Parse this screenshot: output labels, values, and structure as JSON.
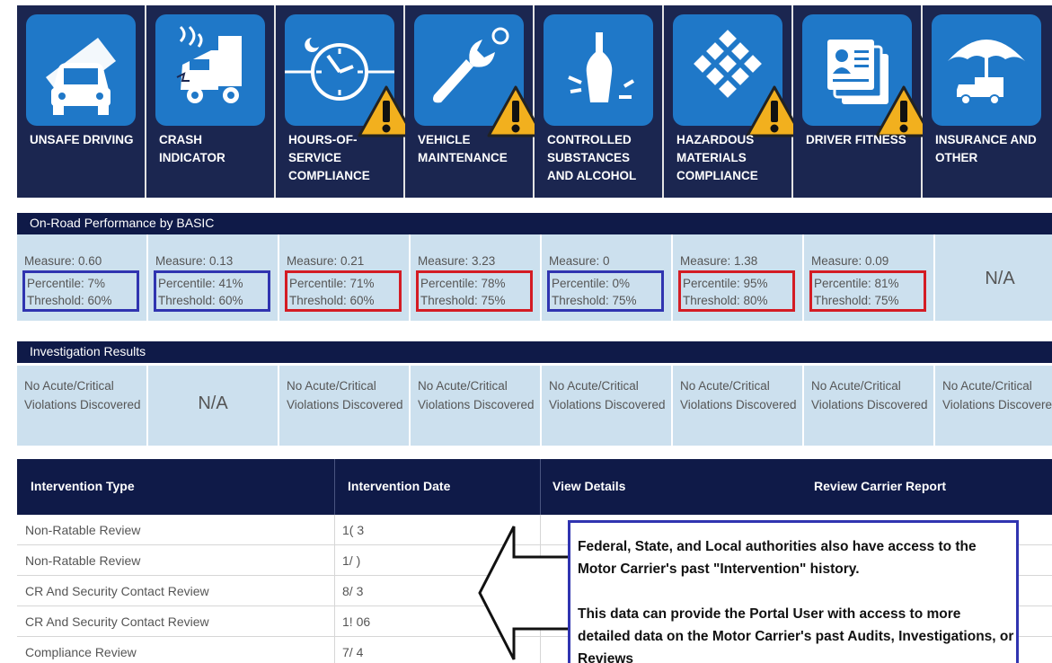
{
  "basics": [
    {
      "label": "UNSAFE DRIVING",
      "icon": "unsafe-driving-icon",
      "warning": false
    },
    {
      "label": "CRASH INDICATOR",
      "icon": "crash-indicator-icon",
      "warning": false
    },
    {
      "label": "HOURS-OF-SERVICE COMPLIANCE",
      "icon": "hours-of-service-icon",
      "warning": true
    },
    {
      "label": "VEHICLE MAINTENANCE",
      "icon": "vehicle-maintenance-icon",
      "warning": true
    },
    {
      "label": "CONTROLLED SUBSTANCES AND ALCOHOL",
      "icon": "controlled-substances-icon",
      "warning": false
    },
    {
      "label": "HAZARDOUS MATERIALS COMPLIANCE",
      "icon": "hazardous-materials-icon",
      "warning": true
    },
    {
      "label": "DRIVER FITNESS",
      "icon": "driver-fitness-icon",
      "warning": true
    },
    {
      "label": "INSURANCE AND OTHER",
      "icon": "insurance-icon",
      "warning": false
    }
  ],
  "on_road": {
    "title": "On-Road Performance by BASIC",
    "cells": [
      {
        "measure": "Measure: 0.60",
        "percentile": "Percentile: 7%",
        "threshold": "Threshold: 60%",
        "highlight": "blue"
      },
      {
        "measure": "Measure: 0.13",
        "percentile": "Percentile: 41%",
        "threshold": "Threshold: 60%",
        "highlight": "blue"
      },
      {
        "measure": "Measure: 0.21",
        "percentile": "Percentile: 71%",
        "threshold": "Threshold: 60%",
        "highlight": "red"
      },
      {
        "measure": "Measure: 3.23",
        "percentile": "Percentile: 78%",
        "threshold": "Threshold: 75%",
        "highlight": "red"
      },
      {
        "measure": "Measure: 0",
        "percentile": "Percentile: 0%",
        "threshold": "Threshold: 75%",
        "highlight": "blue"
      },
      {
        "measure": "Measure: 1.38",
        "percentile": "Percentile: 95%",
        "threshold": "Threshold: 80%",
        "highlight": "red"
      },
      {
        "measure": "Measure: 0.09",
        "percentile": "Percentile: 81%",
        "threshold": "Threshold: 75%",
        "highlight": "red"
      }
    ],
    "last_cell": "N/A"
  },
  "investigation": {
    "title": "Investigation Results",
    "cells": [
      "No Acute/Critical Violations Discovered",
      "N/A",
      "No Acute/Critical Violations Discovered",
      "No Acute/Critical Violations Discovered",
      "No Acute/Critical Violations Discovered",
      "No Acute/Critical Violations Discovered",
      "No Acute/Critical Violations Discovered",
      "No Acute/Critical Violations Discovered"
    ]
  },
  "interventions": {
    "headers": [
      "Intervention Type",
      "Intervention Date",
      "View Details",
      "Review Carrier Report"
    ],
    "rows": [
      {
        "type": "Non-Ratable Review",
        "date": "1(          3"
      },
      {
        "type": "Non-Ratable Review",
        "date": "1/          )"
      },
      {
        "type": "CR And Security Contact Review",
        "date": "8/          3"
      },
      {
        "type": "CR And Security Contact Review",
        "date": "1!          06"
      },
      {
        "type": "Compliance Review",
        "date": "7/          4"
      }
    ]
  },
  "callout": {
    "line1": "Federal, State, and Local authorities also have access to the Motor Carrier's past \"Intervention\" history.",
    "line2": "This data can provide the Portal User with access to more detailed data on the Motor Carrier's past Audits, Investigations, or Reviews"
  },
  "colors": {
    "navy": "#1b2650",
    "tile_blue": "#1f78c8",
    "cell_bg": "#cce0ee",
    "box_blue": "#3034b0",
    "box_red": "#d41c24",
    "warn_yellow": "#f2b01e"
  }
}
